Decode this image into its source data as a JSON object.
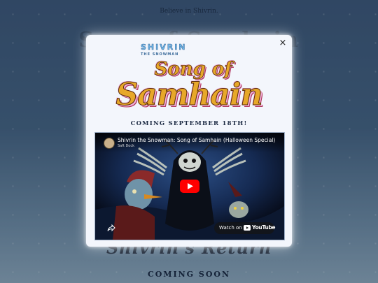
{
  "page": {
    "tagline": "Believe in Shivrin.",
    "background_title_top": "Song of Samhain",
    "background_title_bottom": "Shivrin's Return",
    "coming_soon": "COMING SOON"
  },
  "modal": {
    "close_symbol": "×",
    "logo": {
      "small_title": "SHIVRIN",
      "small_subtitle": "THE SNOWMAN",
      "line1": "Song of",
      "line2": "Samhain"
    },
    "release_text": "COMING SEPTEMBER 18TH!",
    "video": {
      "title": "Shivrin the Snowman: Song of Samhain (Halloween Special)",
      "channel": "Saft Dock",
      "watch_on": "Watch on",
      "platform": "YouTube"
    }
  },
  "colors": {
    "logo_gold": "#e7a829",
    "logo_pink": "#f2b0d9",
    "play_red": "#ff0000",
    "modal_bg": "#f3f6fc"
  },
  "icons": [
    "close-icon",
    "play-icon",
    "share-icon",
    "youtube-logo-icon"
  ]
}
